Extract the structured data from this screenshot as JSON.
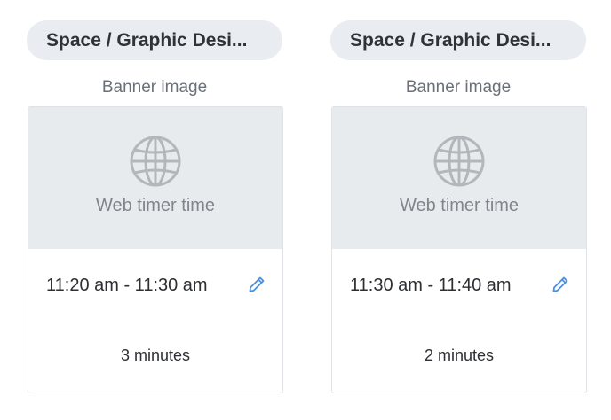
{
  "cards": [
    {
      "chip_label": "Space / Graphic Desi...",
      "section_label": "Banner image",
      "banner_text": "Web timer time",
      "time_range": "11:20 am - 11:30 am",
      "duration": "3 minutes"
    },
    {
      "chip_label": "Space / Graphic Desi...",
      "section_label": "Banner image",
      "banner_text": "Web timer time",
      "time_range": "11:30 am - 11:40 am",
      "duration": "2 minutes"
    }
  ],
  "icons": {
    "banner": "globe-icon",
    "edit": "pencil-icon"
  },
  "colors": {
    "chip_bg": "#e9edf1",
    "banner_bg": "#e8ebee",
    "edit_icon": "#4a90e2",
    "globe_icon": "#b3b7bc"
  }
}
